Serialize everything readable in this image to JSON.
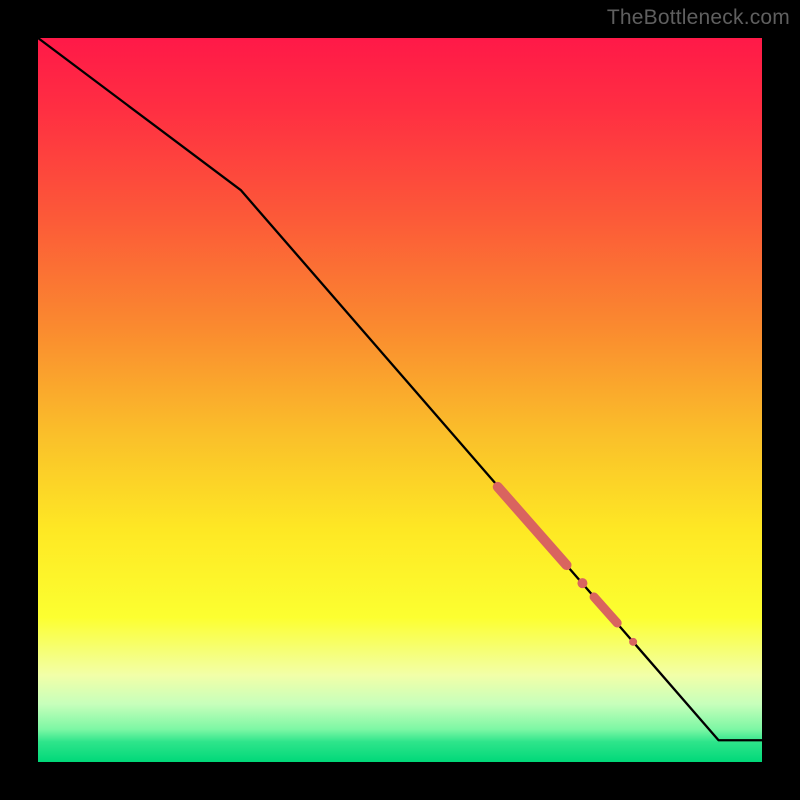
{
  "watermark": {
    "text": "TheBottleneck.com"
  },
  "colors": {
    "background": "#000000",
    "line": "#000000",
    "marker": "#d9645f",
    "gradient_stops": [
      {
        "offset": 0.0,
        "color": "#ff1948"
      },
      {
        "offset": 0.1,
        "color": "#ff2f42"
      },
      {
        "offset": 0.25,
        "color": "#fc5a38"
      },
      {
        "offset": 0.4,
        "color": "#fa8a2f"
      },
      {
        "offset": 0.55,
        "color": "#fac02a"
      },
      {
        "offset": 0.68,
        "color": "#fee824"
      },
      {
        "offset": 0.8,
        "color": "#fcff30"
      },
      {
        "offset": 0.88,
        "color": "#f2ffa8"
      },
      {
        "offset": 0.92,
        "color": "#c7ffbb"
      },
      {
        "offset": 0.955,
        "color": "#7cf7a4"
      },
      {
        "offset": 0.972,
        "color": "#2fe58b"
      },
      {
        "offset": 1.0,
        "color": "#00d879"
      }
    ]
  },
  "chart_data": {
    "type": "line",
    "title": "",
    "xlabel": "",
    "ylabel": "",
    "xlim": [
      0,
      100
    ],
    "ylim": [
      0,
      100
    ],
    "grid": false,
    "legend": false,
    "series": [
      {
        "name": "curve",
        "points_xy": [
          [
            0,
            100
          ],
          [
            28,
            79
          ],
          [
            94,
            3
          ],
          [
            100,
            3
          ]
        ]
      }
    ],
    "markers": [
      {
        "name": "segment-a",
        "type": "capsule",
        "p0_xy": [
          63.5,
          38.0
        ],
        "p1_xy": [
          73.0,
          27.2
        ],
        "width": 10
      },
      {
        "name": "dot-b",
        "type": "dot",
        "p_xy": [
          75.2,
          24.7
        ],
        "r": 5
      },
      {
        "name": "segment-c",
        "type": "capsule",
        "p0_xy": [
          76.8,
          22.8
        ],
        "p1_xy": [
          80.0,
          19.2
        ],
        "width": 9
      },
      {
        "name": "dot-d",
        "type": "dot",
        "p_xy": [
          82.2,
          16.6
        ],
        "r": 4
      }
    ]
  }
}
